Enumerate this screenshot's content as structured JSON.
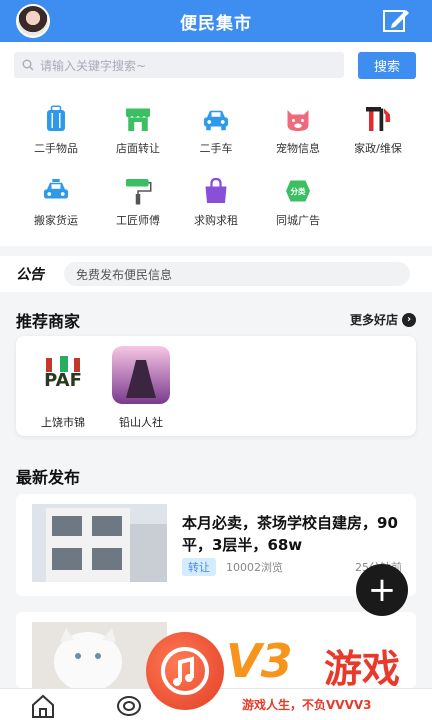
{
  "header": {
    "title": "便民集市",
    "avatar_icon": "avatar",
    "edit_icon": "edit-icon"
  },
  "search": {
    "placeholder": "请输入关键字搜索~",
    "button_label": "搜索"
  },
  "categories": [
    {
      "label": "二手物品",
      "icon": "luggage-icon",
      "color": "#2f9be8"
    },
    {
      "label": "店面转让",
      "icon": "storefront-icon",
      "color": "#3cbf62"
    },
    {
      "label": "二手车",
      "icon": "car-icon",
      "color": "#2f9be8"
    },
    {
      "label": "宠物信息",
      "icon": "pig-icon",
      "color": "#ef6b7b"
    },
    {
      "label": "家政/维保",
      "icon": "tools-icon",
      "color": "#e02c2c"
    },
    {
      "label": "搬家货运",
      "icon": "taxi-icon",
      "color": "#2f9be8"
    },
    {
      "label": "工匠师傅",
      "icon": "paint-roller-icon",
      "color": "#3cbf62"
    },
    {
      "label": "求购求租",
      "icon": "shopping-bag-icon",
      "color": "#8a4fd8"
    },
    {
      "label": "同城广告",
      "icon": "classify-icon",
      "color": "#3cbf62"
    }
  ],
  "notice": {
    "tag": "公告",
    "text": "免费发布便民信息"
  },
  "merchants": {
    "title": "推荐商家",
    "more_label": "更多好店",
    "items": [
      {
        "name": "上饶市锦"
      },
      {
        "name": "铅山人社"
      }
    ]
  },
  "latest": {
    "title": "最新发布",
    "posts": [
      {
        "title": "本月必卖，茶场学校自建房，90平，3层半，68w",
        "badge": "转让",
        "views": "10002浏览",
        "time": "25分钟前"
      }
    ]
  },
  "fab": {
    "label": "+"
  },
  "watermark": {
    "brand": "V3",
    "brand2": "游戏",
    "slogan": "游戏人生，不负VVVV3"
  }
}
